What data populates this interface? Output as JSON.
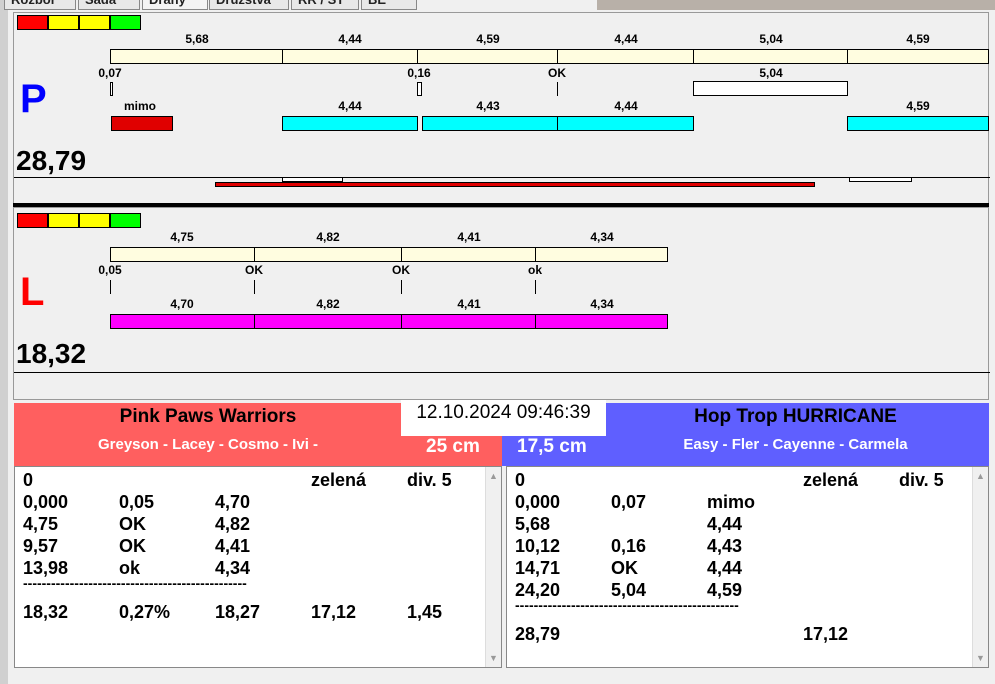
{
  "tabs": [
    "Rozbor",
    "Sada",
    "Dráhy",
    "Družstva",
    "RR / ST",
    "BE"
  ],
  "colors": {
    "red": "#ff0000",
    "yellow": "#ffff00",
    "green": "#00ff00",
    "cream": "#fffde0",
    "cyan": "#00ffff",
    "magenta": "#ff00ff",
    "team_left": "#ff5f5f",
    "team_right": "#5f5fff"
  },
  "lane_p": {
    "letter": "P",
    "score": "28,79",
    "top_labels": [
      "5,68",
      "4,44",
      "4,59",
      "4,44",
      "5,04",
      "4,59"
    ],
    "mid_labels": [
      "0,07",
      "0,16",
      "OK",
      "5,04"
    ],
    "bot_labels": [
      "mimo",
      "4,44",
      "4,43",
      "4,44",
      "4,59"
    ]
  },
  "lane_l": {
    "letter": "L",
    "score": "18,32",
    "top_labels": [
      "4,75",
      "4,82",
      "4,41",
      "4,34"
    ],
    "mid_labels": [
      "0,05",
      "OK",
      "OK",
      "ok"
    ],
    "bot_labels": [
      "4,70",
      "4,82",
      "4,41",
      "4,34"
    ]
  },
  "datetime": "12.10.2024 09:46:39",
  "left_team": {
    "name": "Pink Paws Warriors",
    "members": "Greyson - Lacey - Cosmo - Ivi -",
    "height": "25 cm",
    "header": [
      "0",
      "",
      "",
      "zelená",
      "div. 5"
    ],
    "rows": [
      [
        "0,000",
        "0,05",
        "4,70",
        "",
        ""
      ],
      [
        "4,75",
        "OK",
        "4,82",
        "",
        ""
      ],
      [
        "9,57",
        "OK",
        "4,41",
        "",
        ""
      ],
      [
        "13,98",
        "ok",
        "4,34",
        "",
        ""
      ]
    ],
    "divider": "------------------------------------------------",
    "total": [
      "18,32",
      "0,27%",
      "18,27",
      "17,12",
      "1,45"
    ]
  },
  "right_team": {
    "name": "Hop Trop HURRICANE",
    "members": "Easy - Fler - Cayenne - Carmela",
    "height": "17,5 cm",
    "header": [
      "0",
      "",
      "",
      "zelená",
      "div. 5"
    ],
    "rows": [
      [
        "0,000",
        "0,07",
        "mimo",
        "",
        ""
      ],
      [
        "5,68",
        "",
        "4,44",
        "",
        ""
      ],
      [
        "10,12",
        "0,16",
        "4,43",
        "",
        ""
      ],
      [
        "14,71",
        "OK",
        "4,44",
        "",
        ""
      ],
      [
        "24,20",
        "5,04",
        "4,59",
        "",
        ""
      ]
    ],
    "divider": "------------------------------------------------",
    "total": [
      "28,79",
      "",
      "",
      "17,12",
      ""
    ]
  }
}
